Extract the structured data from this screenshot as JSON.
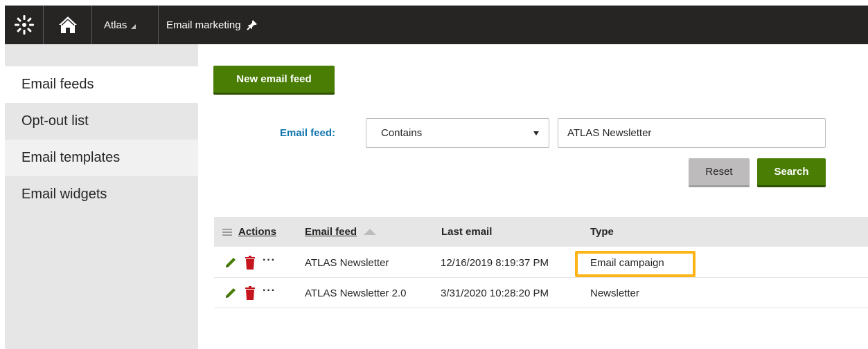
{
  "topbar": {
    "logo_icon": "kentico-logo-icon",
    "home_icon": "home-icon",
    "site_label": "Atlas",
    "app_label": "Email marketing",
    "pin_icon": "pin-icon"
  },
  "sidebar": {
    "items": [
      {
        "label": "Email feeds",
        "active": true
      },
      {
        "label": "Opt-out list",
        "active": false
      },
      {
        "label": "Email templates",
        "active": false
      },
      {
        "label": "Email widgets",
        "active": false
      }
    ]
  },
  "main": {
    "new_button_label": "New email feed",
    "filter": {
      "label": "Email feed:",
      "operator_selected": "Contains",
      "value": "ATLAS Newsletter"
    },
    "reset_label": "Reset",
    "search_label": "Search"
  },
  "table": {
    "columns": [
      "Actions",
      "Email feed",
      "Last email",
      "Type"
    ],
    "rows": [
      {
        "email_feed": "ATLAS Newsletter",
        "last_email": "12/16/2019 8:19:37 PM",
        "type": "Email campaign"
      },
      {
        "email_feed": "ATLAS Newsletter 2.0",
        "last_email": "3/31/2020 10:28:20 PM",
        "type": "Newsletter"
      }
    ]
  },
  "colors": {
    "topbar_bg": "#262524",
    "primary_green": "#497d04",
    "label_blue": "#1175ae",
    "highlight": "#fcb417",
    "delete_red": "#c4161c",
    "edit_green": "#497d04"
  }
}
